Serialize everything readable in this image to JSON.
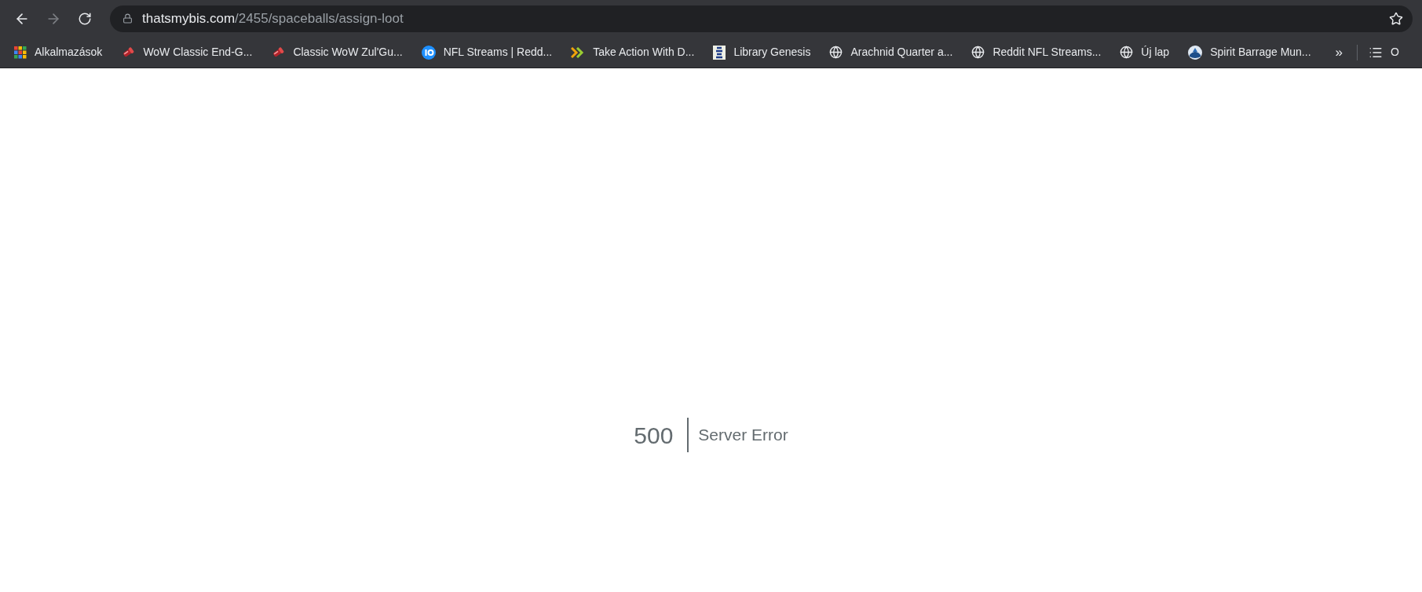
{
  "address_bar": {
    "host": "thatsmybis.com",
    "path": "/2455/spaceballs/assign-loot"
  },
  "bookmarks": [
    {
      "label": "Alkalmazások",
      "kind": "apps"
    },
    {
      "label": "WoW Classic End-G...",
      "kind": "item"
    },
    {
      "label": "Classic WoW Zul'Gu...",
      "kind": "item"
    },
    {
      "label": "NFL Streams | Redd...",
      "kind": "io"
    },
    {
      "label": "Take Action With D...",
      "kind": "chevrons"
    },
    {
      "label": "Library Genesis",
      "kind": "book"
    },
    {
      "label": "Arachnid Quarter a...",
      "kind": "globe"
    },
    {
      "label": "Reddit NFL Streams...",
      "kind": "globe"
    },
    {
      "label": "Új lap",
      "kind": "globe"
    },
    {
      "label": "Spirit Barrage Mun...",
      "kind": "emblem"
    }
  ],
  "overflow": "»",
  "reading_list": {
    "label": "O"
  },
  "error": {
    "code": "500",
    "message": "Server Error"
  }
}
